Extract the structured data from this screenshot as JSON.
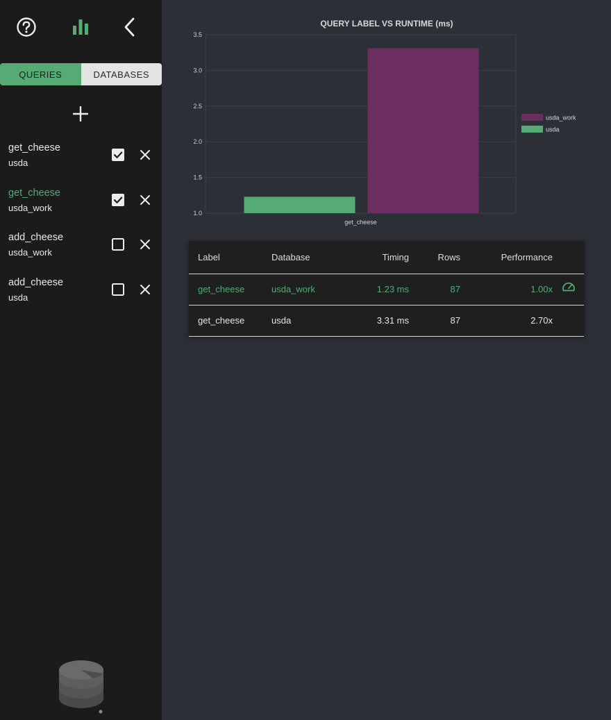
{
  "sidebar": {
    "icons": [
      "help-icon",
      "bar-chart-icon",
      "chevron-left-icon"
    ],
    "tabs": [
      {
        "label": "QUERIES",
        "active": true
      },
      {
        "label": "DATABASES",
        "active": false
      }
    ],
    "add_icon": "plus-icon",
    "queries": [
      {
        "label": "get_cheese",
        "database": "usda",
        "checked": true,
        "active": false
      },
      {
        "label": "get_cheese",
        "database": "usda_work",
        "checked": true,
        "active": true
      },
      {
        "label": "add_cheese",
        "database": "usda_work",
        "checked": false,
        "active": false
      },
      {
        "label": "add_cheese",
        "database": "usda",
        "checked": false,
        "active": false
      }
    ]
  },
  "colors": {
    "accent_green": "#55ab73",
    "series_purple": "#6c2e61",
    "sidebar_bg": "#1b1b1b",
    "main_bg": "#2c2f36"
  },
  "chart_data": {
    "type": "bar",
    "title": "QUERY LABEL VS RUNTIME (ms)",
    "categories": [
      "get_cheese"
    ],
    "series": [
      {
        "name": "usda_work",
        "values": [
          3.31
        ],
        "color": "#6c2e61"
      },
      {
        "name": "usda",
        "values": [
          1.23
        ],
        "color": "#55ab73"
      }
    ],
    "ylim": [
      1.0,
      3.5
    ],
    "yticks": [
      "1.0",
      "1.5",
      "2.0",
      "2.5",
      "3.0",
      "3.5"
    ],
    "grid": true,
    "legend": "right"
  },
  "results": {
    "headers": [
      "Label",
      "Database",
      "Timing",
      "Rows",
      "Performance"
    ],
    "rows": [
      {
        "label": "get_cheese",
        "database": "usda_work",
        "timing": "1.23 ms",
        "rows": "87",
        "performance": "1.00x",
        "best": true,
        "icon": "speedometer-icon"
      },
      {
        "label": "get_cheese",
        "database": "usda",
        "timing": "3.31 ms",
        "rows": "87",
        "performance": "2.70x",
        "best": false
      }
    ]
  }
}
